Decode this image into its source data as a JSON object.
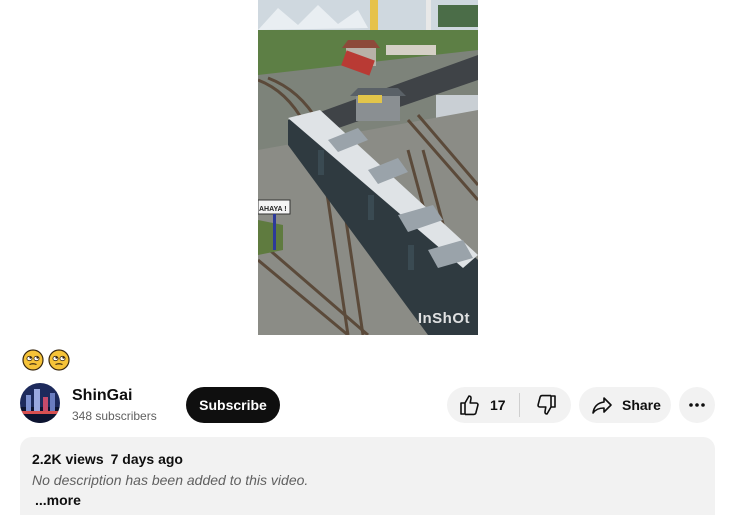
{
  "video": {
    "watermark": "InShOt",
    "sign_text": "AHAYA !"
  },
  "emojis": [
    "face-with-rolling-eyes",
    "face-with-rolling-eyes"
  ],
  "channel": {
    "name": "ShinGai",
    "subscribers": "348 subscribers"
  },
  "subscribe_label": "Subscribe",
  "like_count": "17",
  "share_label": "Share",
  "description": {
    "views": "2.2K views",
    "age": "7 days ago",
    "text": "No description has been added to this video.",
    "more": "...more"
  },
  "colors": {
    "subscribe_bg": "#0f0f0f",
    "pill_bg": "#f2f2f2",
    "emoji_yellow": "#f6c338"
  }
}
